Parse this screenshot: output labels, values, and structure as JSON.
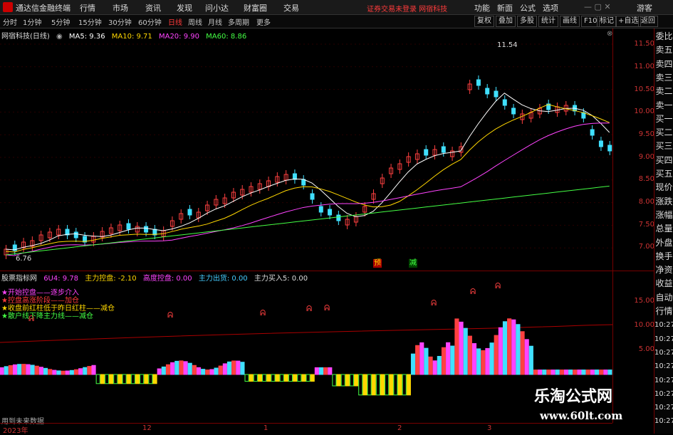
{
  "window": {
    "app_name": "通达信金融终端",
    "warning": "证券交易未登录  网宿科技"
  },
  "menu": [
    "行情",
    "市场",
    "资讯",
    "发现",
    "问小达",
    "财富圈",
    "交易"
  ],
  "title_right": [
    "功能",
    "新面",
    "公式",
    "选项",
    "游客"
  ],
  "periods": [
    "分时",
    "1分钟",
    "5分钟",
    "15分钟",
    "30分钟",
    "60分钟",
    "日线",
    "周线",
    "月线",
    "多周期",
    "更多"
  ],
  "active_period": "日线",
  "toolbar_right": [
    "复权",
    "叠加",
    "多股",
    "统计",
    "画线",
    "F10",
    "标记",
    "+自选",
    "返回"
  ],
  "stock": {
    "title": "网宿科技(日线)"
  },
  "ma": [
    {
      "label": "MA5: 9.36",
      "color": "#ffffff"
    },
    {
      "label": "MA10: 9.71",
      "color": "#ffd700"
    },
    {
      "label": "MA20: 9.90",
      "color": "#ff44ff"
    },
    {
      "label": "MA60: 8.86",
      "color": "#44ff44"
    }
  ],
  "price_axis": [
    "11.50",
    "11.00",
    "10.50",
    "10.00",
    "9.50",
    "9.00",
    "8.50",
    "8.00",
    "7.50",
    "7.00"
  ],
  "high_label": "11.54",
  "low_label": "6.76",
  "signals": [
    {
      "text": "预",
      "color": "#ffd700"
    },
    {
      "text": "减",
      "color": "#44ff44"
    }
  ],
  "lower_legend": [
    {
      "text": "股票指标网",
      "color": "#dddddd"
    },
    {
      "text": "6U4: 9.78",
      "color": "#ff44ff"
    },
    {
      "text": "主力控盘: -2.10",
      "color": "#ffd700"
    },
    {
      "text": "高度控盘: 0.00",
      "color": "#ff44ff"
    },
    {
      "text": "主力出货: 0.00",
      "color": "#44ccff"
    },
    {
      "text": "主力买入5: 0.00",
      "color": "#dddddd"
    }
  ],
  "notes": [
    {
      "text": "★开始控盘——逐步介入",
      "color": "#ff44ff"
    },
    {
      "text": "★控盘高涨阶段——加仓",
      "color": "#ff3b3b"
    },
    {
      "text": "★收盘前红柱低于昨日红柱——减仓",
      "color": "#ffd700"
    },
    {
      "text": "★散户线下降主力线——减仓",
      "color": "#44ff44"
    }
  ],
  "lower_axis": [
    "15.00",
    "10.00",
    "5.00"
  ],
  "right_panel": [
    "委比",
    "卖五",
    "卖四",
    "卖三",
    "卖二",
    "卖一",
    "买一",
    "买二",
    "买三",
    "买四",
    "买五",
    "现价",
    "涨跌",
    "涨幅",
    "总量",
    "外盘",
    "换手",
    "净资",
    "收益",
    "自动",
    "行情",
    "10:27",
    "10:27",
    "10:27",
    "10:27",
    "10:27",
    "10:27",
    "10:27",
    "10:27"
  ],
  "x_axis": [
    "2023年",
    "12",
    "1",
    "2",
    "3"
  ],
  "no_data": "用到未来数据",
  "watermark": {
    "line1": "乐淘公式网",
    "line2": "www.60lt.com"
  }
}
